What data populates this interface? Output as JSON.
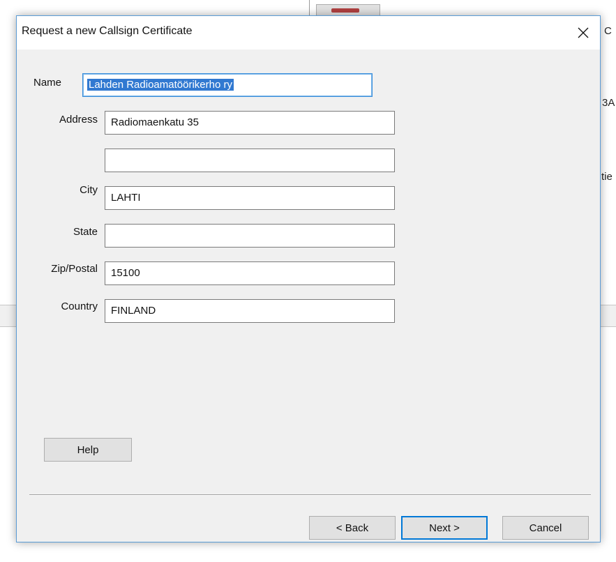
{
  "background": {
    "right_fragments": [
      "C",
      "3A",
      "tie"
    ]
  },
  "dialog": {
    "title": "Request a new Callsign Certificate",
    "close_glyph": "✕"
  },
  "form": {
    "name_label": "Name",
    "name_value": "Lahden Radioamatöörikerho ry",
    "address_label": "Address",
    "address1_value": "Radiomaenkatu 35",
    "address2_value": "",
    "city_label": "City",
    "city_value": "LAHTI",
    "state_label": "State",
    "state_value": "",
    "zip_label": "Zip/Postal",
    "zip_value": "15100",
    "country_label": "Country",
    "country_value": "FINLAND"
  },
  "buttons": {
    "help": "Help",
    "back": "< Back",
    "next": "Next >",
    "cancel": "Cancel"
  }
}
